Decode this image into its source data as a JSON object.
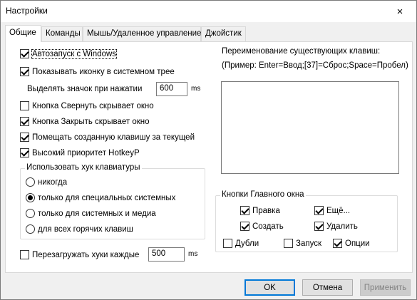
{
  "window": {
    "title": "Настройки",
    "close_icon": "×"
  },
  "tabs": [
    {
      "label": "Общие",
      "active": true
    },
    {
      "label": "Команды"
    },
    {
      "label": "Мышь/Удаленное управление"
    },
    {
      "label": "Джойстик"
    }
  ],
  "general": {
    "autostart": {
      "label": "Автозапуск с Windows",
      "checked": true
    },
    "show_tray_icon": {
      "label": "Показывать иконку в системном трее",
      "checked": true
    },
    "highlight_icon": {
      "label": "Выделять значок при нажатии",
      "value": "600",
      "unit": "ms"
    },
    "minimize_hides": {
      "label": "Кнопка Свернуть скрывает окно",
      "checked": false
    },
    "close_hides": {
      "label": "Кнопка Закрыть скрывает окно",
      "checked": true
    },
    "place_after_current": {
      "label": "Помещать созданную клавишу за текущей",
      "checked": true
    },
    "high_priority": {
      "label": "Высокий приоритет HotkeyP",
      "checked": true
    },
    "hook_group": {
      "title": "Использовать хук клавиатуры",
      "options": [
        {
          "label": "никогда",
          "checked": false
        },
        {
          "label": "только для специальных системных",
          "checked": true
        },
        {
          "label": "только для системных и медиа",
          "checked": false
        },
        {
          "label": "для всех горячих клавиш",
          "checked": false
        }
      ]
    },
    "reload_hooks": {
      "label": "Перезагружать хуки каждые",
      "checked": false,
      "value": "500",
      "unit": "ms"
    }
  },
  "rename": {
    "title": "Переименование существующих клавиш:",
    "example": "(Пример: Enter=Ввод;[37]=Сброс;Space=Пробел)",
    "value": ""
  },
  "main_buttons": {
    "title": "Кнопки Главного окна",
    "edit": {
      "label": "Правка",
      "checked": true
    },
    "more": {
      "label": "Ещё...",
      "checked": true
    },
    "create": {
      "label": "Создать",
      "checked": true
    },
    "delete": {
      "label": "Удалить",
      "checked": true
    },
    "duplicates": {
      "label": "Дубли",
      "checked": false
    },
    "launch": {
      "label": "Запуск",
      "checked": false
    },
    "options": {
      "label": "Опции",
      "checked": true
    }
  },
  "footer": {
    "ok": "OK",
    "cancel": "Отмена",
    "apply": "Применить"
  },
  "colors": {
    "focus_border": "#0078d7"
  }
}
